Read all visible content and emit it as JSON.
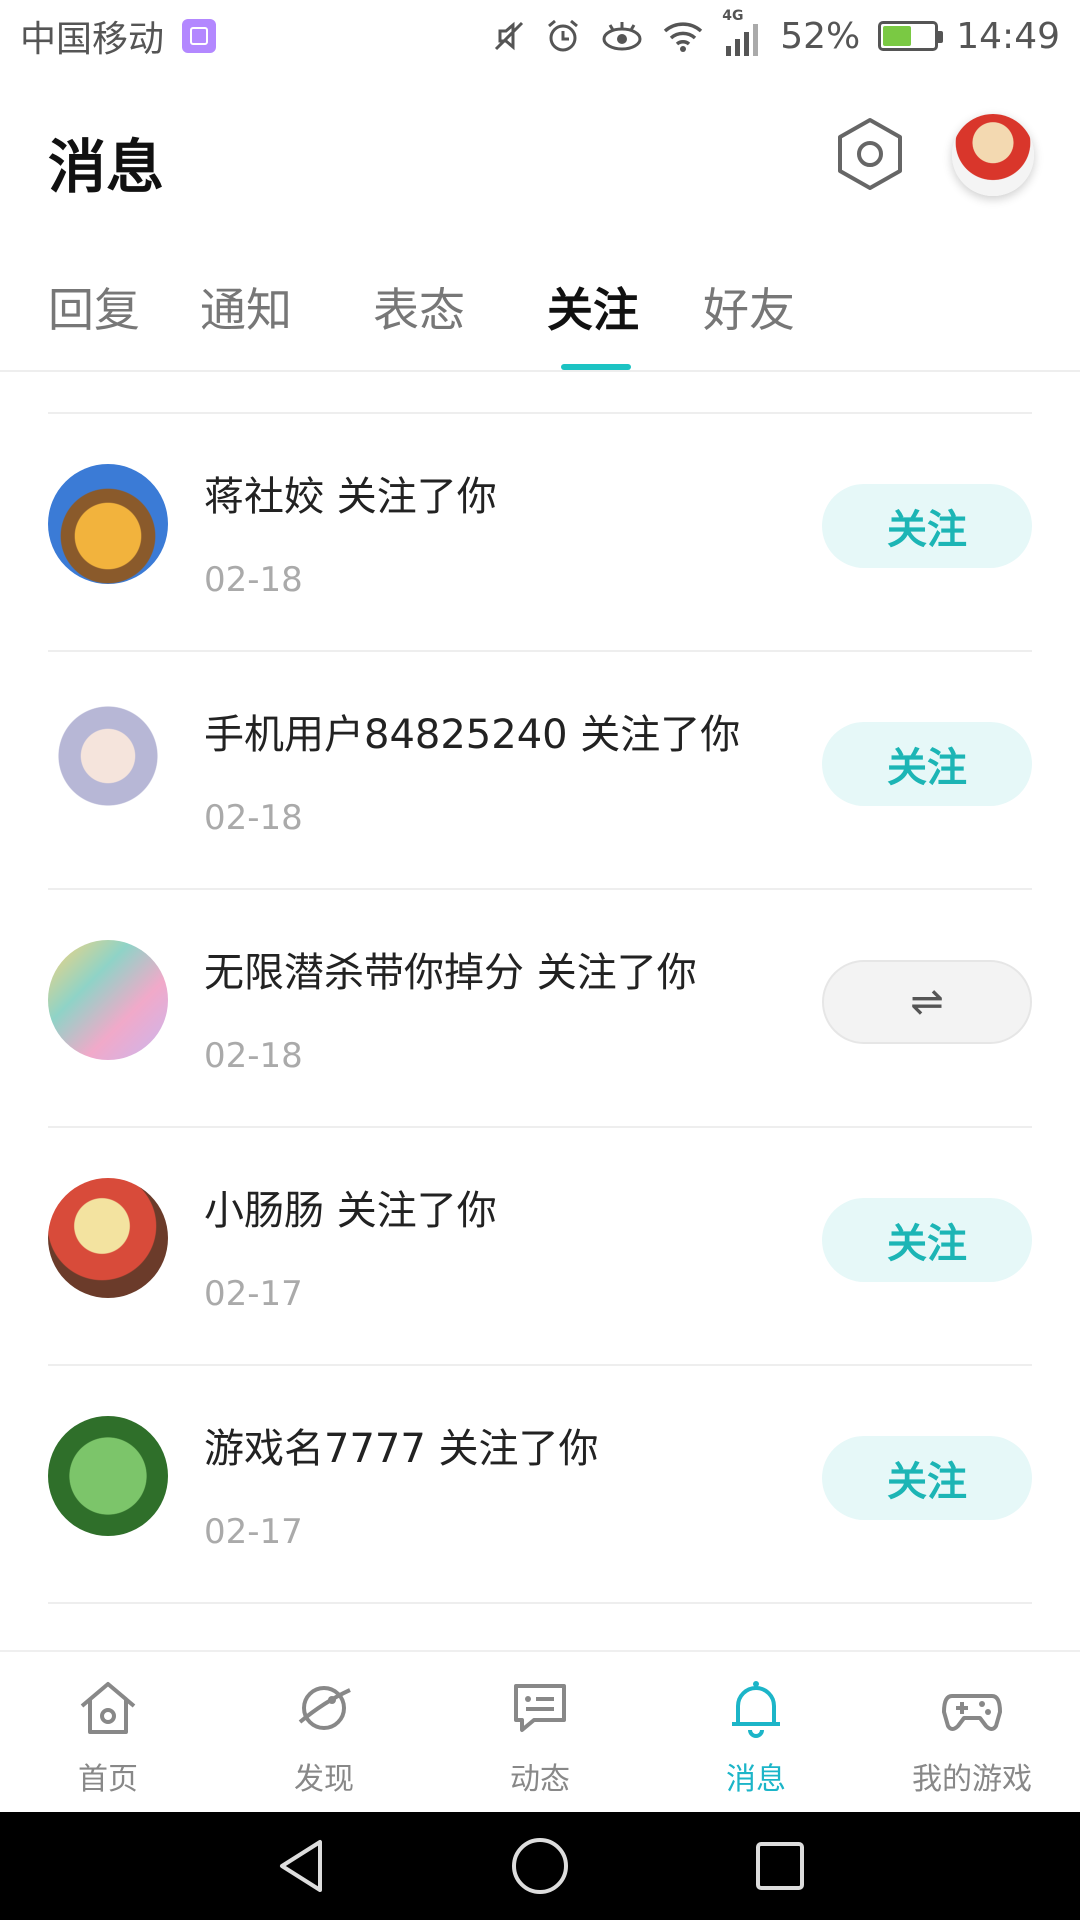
{
  "status_bar": {
    "carrier": "中国移动",
    "network": "4G",
    "battery": "52%",
    "battery_level": 0.52,
    "time": "14:49"
  },
  "header": {
    "title": "消息"
  },
  "tabs": [
    {
      "label": "回复",
      "active": false
    },
    {
      "label": "通知",
      "active": false
    },
    {
      "label": "表态",
      "active": false
    },
    {
      "label": "关注",
      "active": true
    },
    {
      "label": "好友",
      "active": false
    }
  ],
  "follows": [
    {
      "text": "蒋社姣 关注了你",
      "date": "02-18",
      "button": "关注",
      "mutual": false
    },
    {
      "text": "手机用户84825240 关注了你",
      "date": "02-18",
      "button": "关注",
      "mutual": false
    },
    {
      "text": "无限潜杀带你掉分 关注了你",
      "date": "02-18",
      "button": "⇌",
      "mutual": true
    },
    {
      "text": "小肠肠 关注了你",
      "date": "02-17",
      "button": "关注",
      "mutual": false
    },
    {
      "text": "游戏名7777 关注了你",
      "date": "02-17",
      "button": "关注",
      "mutual": false
    }
  ],
  "bottom_nav": [
    {
      "label": "首页",
      "icon": "home-icon",
      "active": false
    },
    {
      "label": "发现",
      "icon": "discover-planet-icon",
      "active": false
    },
    {
      "label": "动态",
      "icon": "feed-chat-icon",
      "active": false
    },
    {
      "label": "消息",
      "icon": "bell-icon",
      "active": true
    },
    {
      "label": "我的游戏",
      "icon": "gamepad-icon",
      "active": false
    }
  ],
  "colors": {
    "accent": "#1cc3c3",
    "follow_button_bg": "#e6f8f8"
  }
}
